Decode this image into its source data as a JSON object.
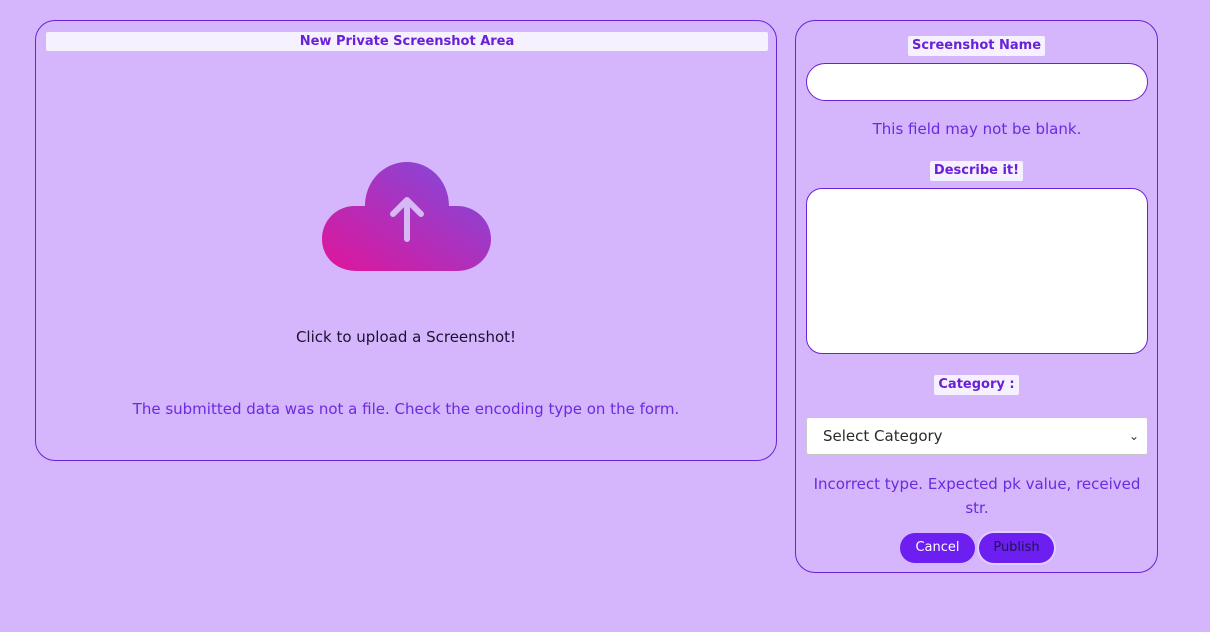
{
  "upload_panel": {
    "title": "New Private Screenshot Area",
    "upload_prompt": "Click to upload a Screenshot!",
    "error": "The submitted data was not a file. Check the encoding type on the form."
  },
  "form": {
    "name_label": "Screenshot Name",
    "name_value": "",
    "name_error": "This field may not be blank.",
    "description_label": "Describe it!",
    "description_value": "",
    "category_label": "Category :",
    "category_selected": "Select Category",
    "category_error": "Incorrect type. Expected pk value, received str.",
    "cancel_label": "Cancel",
    "publish_label": "Publish"
  },
  "colors": {
    "background": "#d5b5fc",
    "accent": "#6c1ff0",
    "error_text": "#6a2bdf",
    "cloud_gradient_start": "#e0159a",
    "cloud_gradient_end": "#7a4de0"
  },
  "icons": {
    "upload": "cloud-upload-icon",
    "select_arrow": "chevron-down-icon"
  }
}
